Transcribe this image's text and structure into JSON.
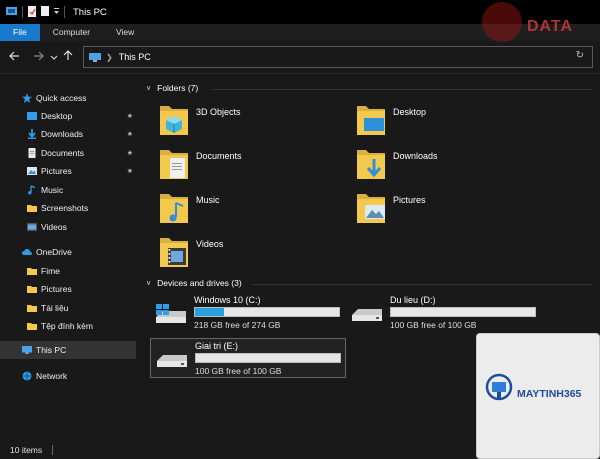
{
  "window": {
    "title": "This PC"
  },
  "ribbon": {
    "tabs": [
      "File",
      "Computer",
      "View"
    ]
  },
  "address": {
    "path": "This PC"
  },
  "sidebar": {
    "items": [
      {
        "label": "Quick access",
        "level": 1,
        "icon": "star-icon",
        "pinned": false
      },
      {
        "label": "Desktop",
        "level": 2,
        "icon": "desktop-icon",
        "pinned": true
      },
      {
        "label": "Downloads",
        "level": 2,
        "icon": "download-icon",
        "pinned": true
      },
      {
        "label": "Documents",
        "level": 2,
        "icon": "documents-icon",
        "pinned": true
      },
      {
        "label": "Pictures",
        "level": 2,
        "icon": "pictures-icon",
        "pinned": true
      },
      {
        "label": "Music",
        "level": 2,
        "icon": "music-icon",
        "pinned": false
      },
      {
        "label": "Screenshots",
        "level": 2,
        "icon": "folder-icon",
        "pinned": false
      },
      {
        "label": "Videos",
        "level": 2,
        "icon": "videos-icon",
        "pinned": false
      },
      {
        "label": "OneDrive",
        "level": 1,
        "icon": "cloud-icon",
        "pinned": false
      },
      {
        "label": "Fime",
        "level": 2,
        "icon": "folder-icon",
        "pinned": false
      },
      {
        "label": "Pictures",
        "level": 2,
        "icon": "folder-icon",
        "pinned": false
      },
      {
        "label": "Tài liệu",
        "level": 2,
        "icon": "folder-icon",
        "pinned": false
      },
      {
        "label": "Tệp đính kèm",
        "level": 2,
        "icon": "folder-icon",
        "pinned": false
      },
      {
        "label": "This PC",
        "level": 1,
        "icon": "pc-icon",
        "pinned": false,
        "selected": true
      },
      {
        "label": "Network",
        "level": 1,
        "icon": "network-icon",
        "pinned": false
      }
    ]
  },
  "folders": {
    "header": "Folders (7)",
    "items": [
      {
        "name": "3D Objects",
        "icon": "3d-objects-folder-icon"
      },
      {
        "name": "Desktop",
        "icon": "desktop-folder-icon"
      },
      {
        "name": "Documents",
        "icon": "documents-folder-icon"
      },
      {
        "name": "Downloads",
        "icon": "downloads-folder-icon"
      },
      {
        "name": "Music",
        "icon": "music-folder-icon"
      },
      {
        "name": "Pictures",
        "icon": "pictures-folder-icon"
      },
      {
        "name": "Videos",
        "icon": "videos-folder-icon"
      }
    ]
  },
  "drives": {
    "header": "Devices and drives (3)",
    "items": [
      {
        "name": "Windows 10 (C:)",
        "free": "218 GB free of 274 GB",
        "used_fraction": 0.2,
        "icon": "windows-drive-icon"
      },
      {
        "name": "Du lieu (D:)",
        "free": "100 GB free of 100 GB",
        "used_fraction": 0.0,
        "icon": "drive-icon"
      },
      {
        "name": "Giai tri (E:)",
        "free": "100 GB free of 100 GB",
        "used_fraction": 0.0,
        "icon": "drive-icon",
        "selected": true
      }
    ]
  },
  "status": {
    "count": "10 items"
  },
  "watermarks": {
    "top": "DATA",
    "bottom_brand": "MAYTINH365"
  },
  "colors": {
    "accent": "#1979ca",
    "bar_fill": "#26a0da",
    "folder_yellow": "#f2c94c"
  }
}
